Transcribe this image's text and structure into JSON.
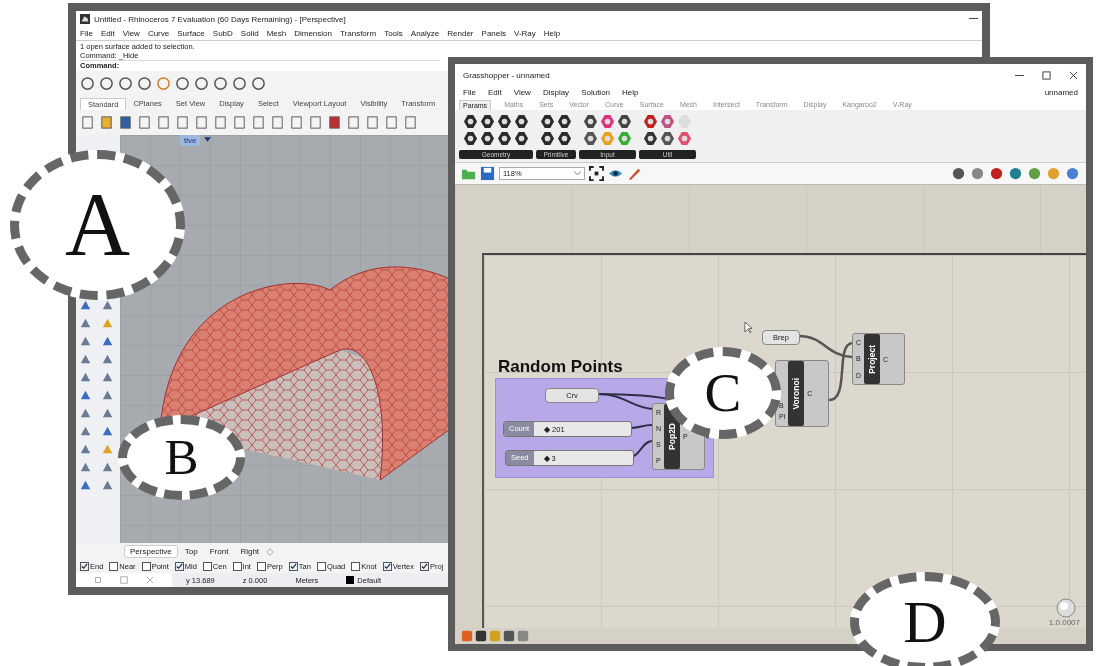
{
  "rhino": {
    "title": "Untitled - Rhinoceros 7 Evaluation (60 Days Remaining) - [Perspective]",
    "menu": [
      "File",
      "Edit",
      "View",
      "Curve",
      "Surface",
      "SubD",
      "Solid",
      "Mesh",
      "Dimension",
      "Transform",
      "Tools",
      "Analyze",
      "Render",
      "Panels",
      "V-Ray",
      "Help"
    ],
    "command_history": [
      "1 open surface added to selection.",
      "Command: _Hide"
    ],
    "command_prompt": "Command:",
    "toolbar_tabs": [
      {
        "label": "Standard",
        "selected": true
      },
      {
        "label": "CPlanes",
        "selected": false
      },
      {
        "label": "Set View",
        "selected": false
      },
      {
        "label": "Display",
        "selected": false
      },
      {
        "label": "Select",
        "selected": false
      },
      {
        "label": "Viewport Layout",
        "selected": false
      },
      {
        "label": "Visibility",
        "selected": false
      },
      {
        "label": "Transform",
        "selected": false
      }
    ],
    "viewport_label": "tive",
    "viewport_tabs": [
      {
        "label": "Perspective",
        "selected": true
      },
      {
        "label": "Top",
        "selected": false
      },
      {
        "label": "Front",
        "selected": false
      },
      {
        "label": "Right",
        "selected": false
      }
    ],
    "osnaps": [
      {
        "label": "End",
        "checked": true
      },
      {
        "label": "Near",
        "checked": false
      },
      {
        "label": "Point",
        "checked": false
      },
      {
        "label": "Mid",
        "checked": true
      },
      {
        "label": "Cen",
        "checked": false
      },
      {
        "label": "Int",
        "checked": false
      },
      {
        "label": "Perp",
        "checked": false
      },
      {
        "label": "Tan",
        "checked": true
      },
      {
        "label": "Quad",
        "checked": false
      },
      {
        "label": "Knot",
        "checked": false
      },
      {
        "label": "Vertex",
        "checked": true
      },
      {
        "label": "Proj",
        "checked": true
      }
    ],
    "status": [
      "y 13.689",
      "z 0.000",
      "Meters",
      "Default"
    ]
  },
  "grasshopper": {
    "title": "Grasshopper - unnamed",
    "document": "unnamed",
    "menu": [
      "File",
      "Edit",
      "View",
      "Display",
      "Solution",
      "Help"
    ],
    "tabs": [
      {
        "label": "Params",
        "selected": true
      },
      {
        "label": "Maths",
        "selected": false
      },
      {
        "label": "Sets",
        "selected": false
      },
      {
        "label": "Vector",
        "selected": false
      },
      {
        "label": "Curve",
        "selected": false
      },
      {
        "label": "Surface",
        "selected": false
      },
      {
        "label": "Mesh",
        "selected": false
      },
      {
        "label": "Intersect",
        "selected": false
      },
      {
        "label": "Transform",
        "selected": false
      },
      {
        "label": "Display",
        "selected": false
      },
      {
        "label": "Kangaroo2",
        "selected": false
      },
      {
        "label": "V-Ray",
        "selected": false
      }
    ],
    "ribbon_groups": [
      {
        "label": "Geometry"
      },
      {
        "label": "Primitive"
      },
      {
        "label": "Input"
      },
      {
        "label": "Util"
      }
    ],
    "zoom": "118%",
    "group": {
      "title": "Random Points"
    },
    "params": [
      {
        "label": "Crv"
      },
      {
        "label": "Brep"
      }
    ],
    "sliders": [
      {
        "label": "Count",
        "value": "◆ 201"
      },
      {
        "label": "Seed",
        "value": "◆ 3"
      }
    ],
    "components": [
      {
        "name": "Pop2D",
        "inputs": [
          "R",
          "N",
          "S",
          "P"
        ],
        "outputs": [
          "P"
        ]
      },
      {
        "name": "Voronoi",
        "inputs": [
          "B",
          "Pl"
        ],
        "outputs": [
          "C"
        ]
      },
      {
        "name": "Project",
        "inputs": [
          "C",
          "B",
          "D"
        ],
        "outputs": [
          "C"
        ]
      }
    ],
    "version": "1.0.0007"
  },
  "callouts": [
    "A",
    "B",
    "C",
    "D"
  ]
}
